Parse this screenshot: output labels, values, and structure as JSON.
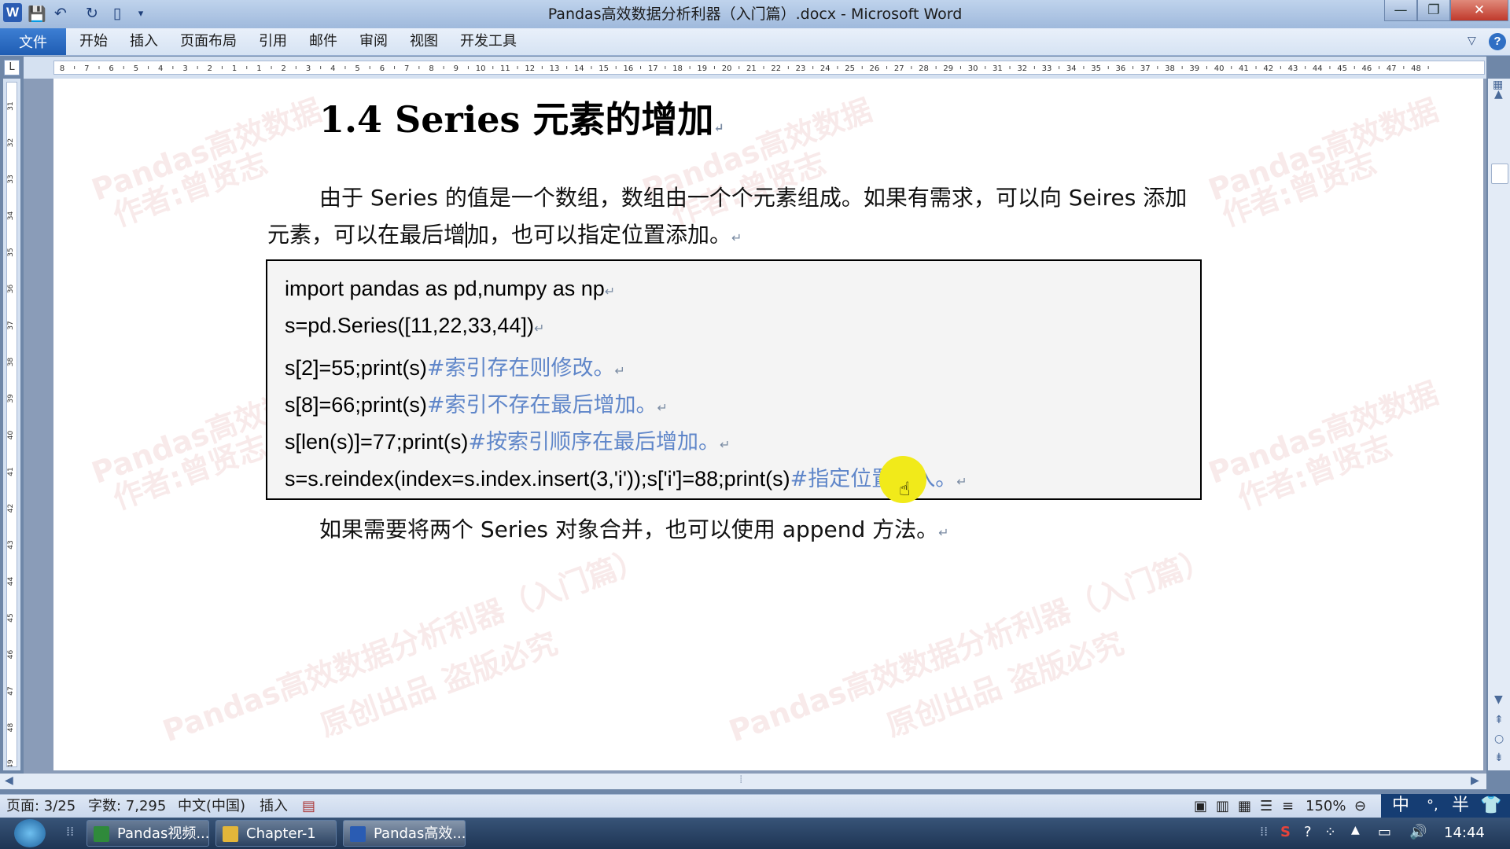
{
  "window": {
    "title": "Pandas高效数据分析利器（入门篇）.docx - Microsoft Word",
    "min_glyph": "—",
    "max_glyph": "❐",
    "close_glyph": "✕",
    "app_logo": "W"
  },
  "quick_access": [
    "save-icon",
    "undo-icon",
    "redo-icon",
    "new-doc-icon",
    "customize-icon"
  ],
  "ribbon": {
    "file_tab": "文件",
    "tabs": [
      "开始",
      "插入",
      "页面布局",
      "引用",
      "邮件",
      "审阅",
      "视图",
      "开发工具"
    ],
    "help": "?"
  },
  "ruler": {
    "corner": "L",
    "h_left_ticks": [
      "8",
      "7",
      "6",
      "5",
      "4",
      "3",
      "2",
      "1"
    ],
    "h_right_ticks": [
      "2",
      "3",
      "4",
      "5",
      "6",
      "7",
      "8",
      "9",
      "10",
      "11",
      "12",
      "13",
      "14",
      "15",
      "16",
      "17",
      "18",
      "19",
      "20",
      "21",
      "22",
      "23",
      "24",
      "25",
      "26",
      "27",
      "28",
      "29",
      "30",
      "31",
      "32",
      "33",
      "34",
      "35",
      "36",
      "37",
      "38",
      "39",
      "40",
      "41",
      "42",
      "43",
      "44",
      "45",
      "46",
      "47",
      "48"
    ],
    "v_ticks": [
      "31",
      "32",
      "33",
      "34",
      "35",
      "36",
      "37",
      "38",
      "39",
      "40",
      "41",
      "42",
      "43",
      "44",
      "45",
      "46",
      "47",
      "48",
      "49"
    ]
  },
  "document": {
    "heading": "1.4 Series 元素的增加",
    "para1_line1": "由于 Series 的值是一个数组，数组由一个个元素组成。如果有需求，可以向 Seires 添加",
    "para1_line2a": "元素，可以在最后增",
    "para1_line2b": "加，也可以指定位置添加。",
    "para_mark": "↵",
    "code": [
      {
        "code": "import pandas as pd,numpy as np",
        "comment": ""
      },
      {
        "code": "s=pd.Series([11,22,33,44])",
        "comment": ""
      },
      {
        "code": "s[2]=55;print(s)",
        "comment": "#索引存在则修改。"
      },
      {
        "code": "s[8]=66;print(s)",
        "comment": "#索引不存在最后增加。"
      },
      {
        "code": "s[len(s)]=77;print(s)",
        "comment": "#按索引顺序在最后增加。"
      },
      {
        "code": "s=s.reindex(index=s.index.insert(3,'i'));s['i']=88;print(s)",
        "comment": "#指定位置插入。"
      }
    ],
    "para2": "如果需要将两个 Series 对象合并，也可以使用 append 方法。",
    "watermarks": [
      "Pandas高效数据",
      "作者:曾贤志",
      "原创出品 盗版必究",
      "Pandas高效数据分析利器（入门篇）"
    ]
  },
  "statusbar": {
    "page": "页面: 3/25",
    "words": "字数: 7,295",
    "language": "中文(中国)",
    "mode": "插入",
    "zoom": "150%"
  },
  "ime": {
    "lang": "中",
    "punct": "°,",
    "width": "半"
  },
  "taskbar": {
    "items": [
      {
        "label": "Pandas视频...",
        "color": "#2f8a3b"
      },
      {
        "label": "Chapter-1",
        "color": "#e3b63a"
      },
      {
        "label": "Pandas高效...",
        "color": "#2a5cb3"
      }
    ],
    "clock": "14:44"
  }
}
